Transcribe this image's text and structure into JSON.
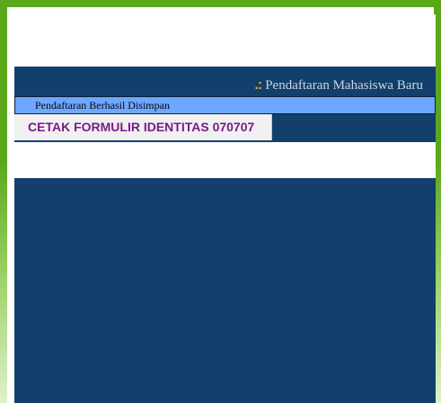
{
  "header": {
    "title_icon": ".:",
    "title": "Pendaftaran Mahasiswa Baru"
  },
  "status": {
    "message": "Pendaftaran Berhasil Disimpan"
  },
  "actions": {
    "print_label": "CETAK FORMULIR IDENTITAS 070707"
  },
  "colors": {
    "frame_green": "#5aa81a",
    "navy": "#123f6b",
    "status_bar": "#6da7ff",
    "icon_orange": "#f2a11a",
    "print_text": "#7a1a8a"
  }
}
